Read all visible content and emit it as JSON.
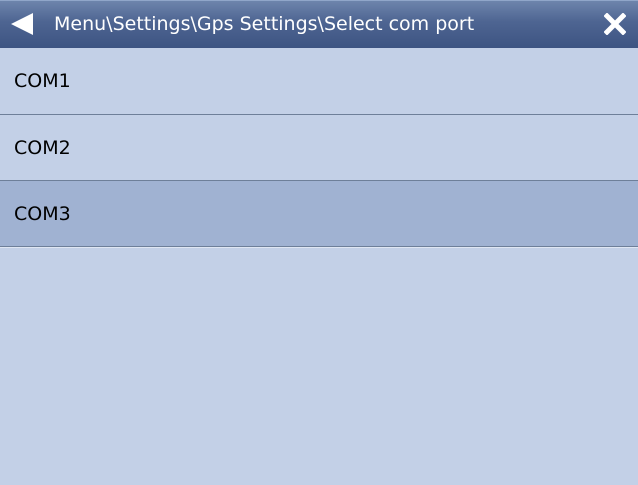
{
  "header": {
    "title": "Menu\\Settings\\Gps Settings\\Select com port",
    "back_icon": "back-arrow-icon",
    "close_icon": "close-icon"
  },
  "ports": {
    "items": [
      {
        "label": "COM1",
        "selected": false
      },
      {
        "label": "COM2",
        "selected": false
      },
      {
        "label": "COM3",
        "selected": true
      }
    ]
  },
  "colors": {
    "titlebar": "#4e6592",
    "background": "#c3d0e7",
    "selected_row": "#a0b2d2",
    "separator": "#6e7f99"
  }
}
